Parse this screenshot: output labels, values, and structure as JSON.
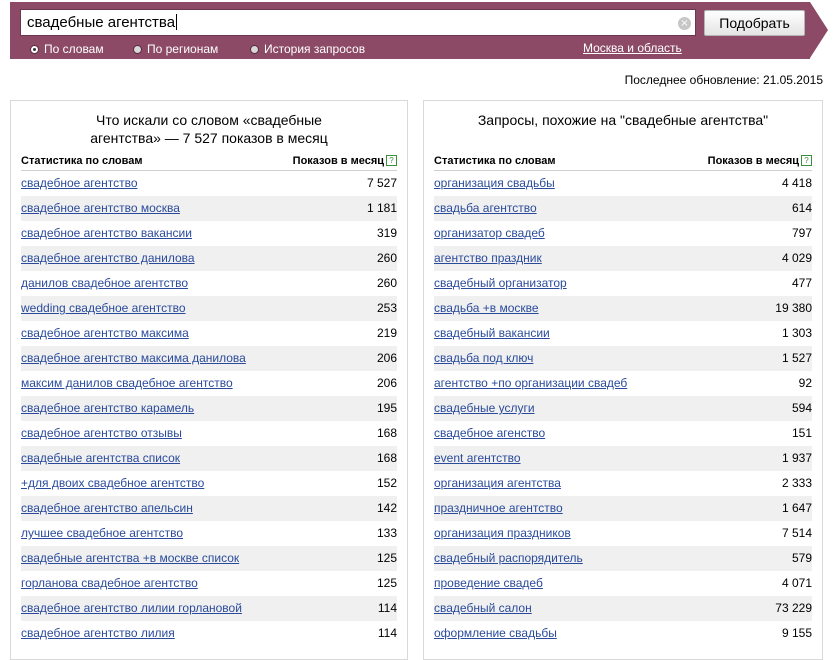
{
  "search": {
    "query": "свадебные агентства",
    "clear_icon": "×",
    "submit_label": "Подобрать",
    "modes": [
      "По словам",
      "По регионам",
      "История запросов"
    ],
    "selected_mode": "По словам",
    "region": "Москва и область"
  },
  "last_update": "Последнее обновление: 21.05.2015",
  "left_panel": {
    "title_line1": "Что искали со словом «свадебные",
    "title_line2": "агентства» — 7 527 показов в месяц",
    "col_keyword": "Статистика по словам",
    "col_count": "Показов в месяц",
    "help": "?",
    "rows": [
      {
        "keyword": "свадебное агентство",
        "count": "7 527"
      },
      {
        "keyword": "свадебное агентство москва",
        "count": "1 181"
      },
      {
        "keyword": "свадебное агентство вакансии",
        "count": "319"
      },
      {
        "keyword": "свадебное агентство данилова",
        "count": "260"
      },
      {
        "keyword": "данилов свадебное агентство",
        "count": "260"
      },
      {
        "keyword": "wedding свадебное агентство",
        "count": "253"
      },
      {
        "keyword": "свадебное агентство максима",
        "count": "219"
      },
      {
        "keyword": "свадебное агентство максима данилова",
        "count": "206"
      },
      {
        "keyword": "максим данилов свадебное агентство",
        "count": "206"
      },
      {
        "keyword": "свадебное агентство карамель",
        "count": "195"
      },
      {
        "keyword": "свадебное агентство отзывы",
        "count": "168"
      },
      {
        "keyword": "свадебные агентства список",
        "count": "168"
      },
      {
        "keyword": "+для двоих свадебное агентство",
        "count": "152"
      },
      {
        "keyword": "свадебное агентство апельсин",
        "count": "142"
      },
      {
        "keyword": "лучшее свадебное агентство",
        "count": "133"
      },
      {
        "keyword": "свадебные агентства +в москве список",
        "count": "125"
      },
      {
        "keyword": "горланова свадебное агентство",
        "count": "125"
      },
      {
        "keyword": "свадебное агентство лилии горлановой",
        "count": "114"
      },
      {
        "keyword": "свадебное агентство лилия",
        "count": "114"
      }
    ]
  },
  "right_panel": {
    "title_line1": "Запросы, похожие на \"свадебные агентства\"",
    "col_keyword": "Статистика по словам",
    "col_count": "Показов в месяц",
    "help": "?",
    "rows": [
      {
        "keyword": "организация свадьбы",
        "count": "4 418"
      },
      {
        "keyword": "свадьба агентство",
        "count": "614"
      },
      {
        "keyword": "организатор свадеб",
        "count": "797"
      },
      {
        "keyword": "агентство праздник",
        "count": "4 029"
      },
      {
        "keyword": "свадебный организатор",
        "count": "477"
      },
      {
        "keyword": "свадьба +в москве",
        "count": "19 380"
      },
      {
        "keyword": "свадебный вакансии",
        "count": "1 303"
      },
      {
        "keyword": "свадьба под ключ",
        "count": "1 527"
      },
      {
        "keyword": "агентство +по организации свадеб",
        "count": "92"
      },
      {
        "keyword": "свадебные услуги",
        "count": "594"
      },
      {
        "keyword": "свадебное агенство",
        "count": "151"
      },
      {
        "keyword": "event агентство",
        "count": "1 937"
      },
      {
        "keyword": "организация агентства",
        "count": "2 333"
      },
      {
        "keyword": "праздничное агентство",
        "count": "1 647"
      },
      {
        "keyword": "организация праздников",
        "count": "7 514"
      },
      {
        "keyword": "свадебный распорядитель",
        "count": "579"
      },
      {
        "keyword": "проведение свадеб",
        "count": "4 071"
      },
      {
        "keyword": "свадебный салон",
        "count": "73 229"
      },
      {
        "keyword": "оформление свадьбы",
        "count": "9 155"
      }
    ]
  }
}
